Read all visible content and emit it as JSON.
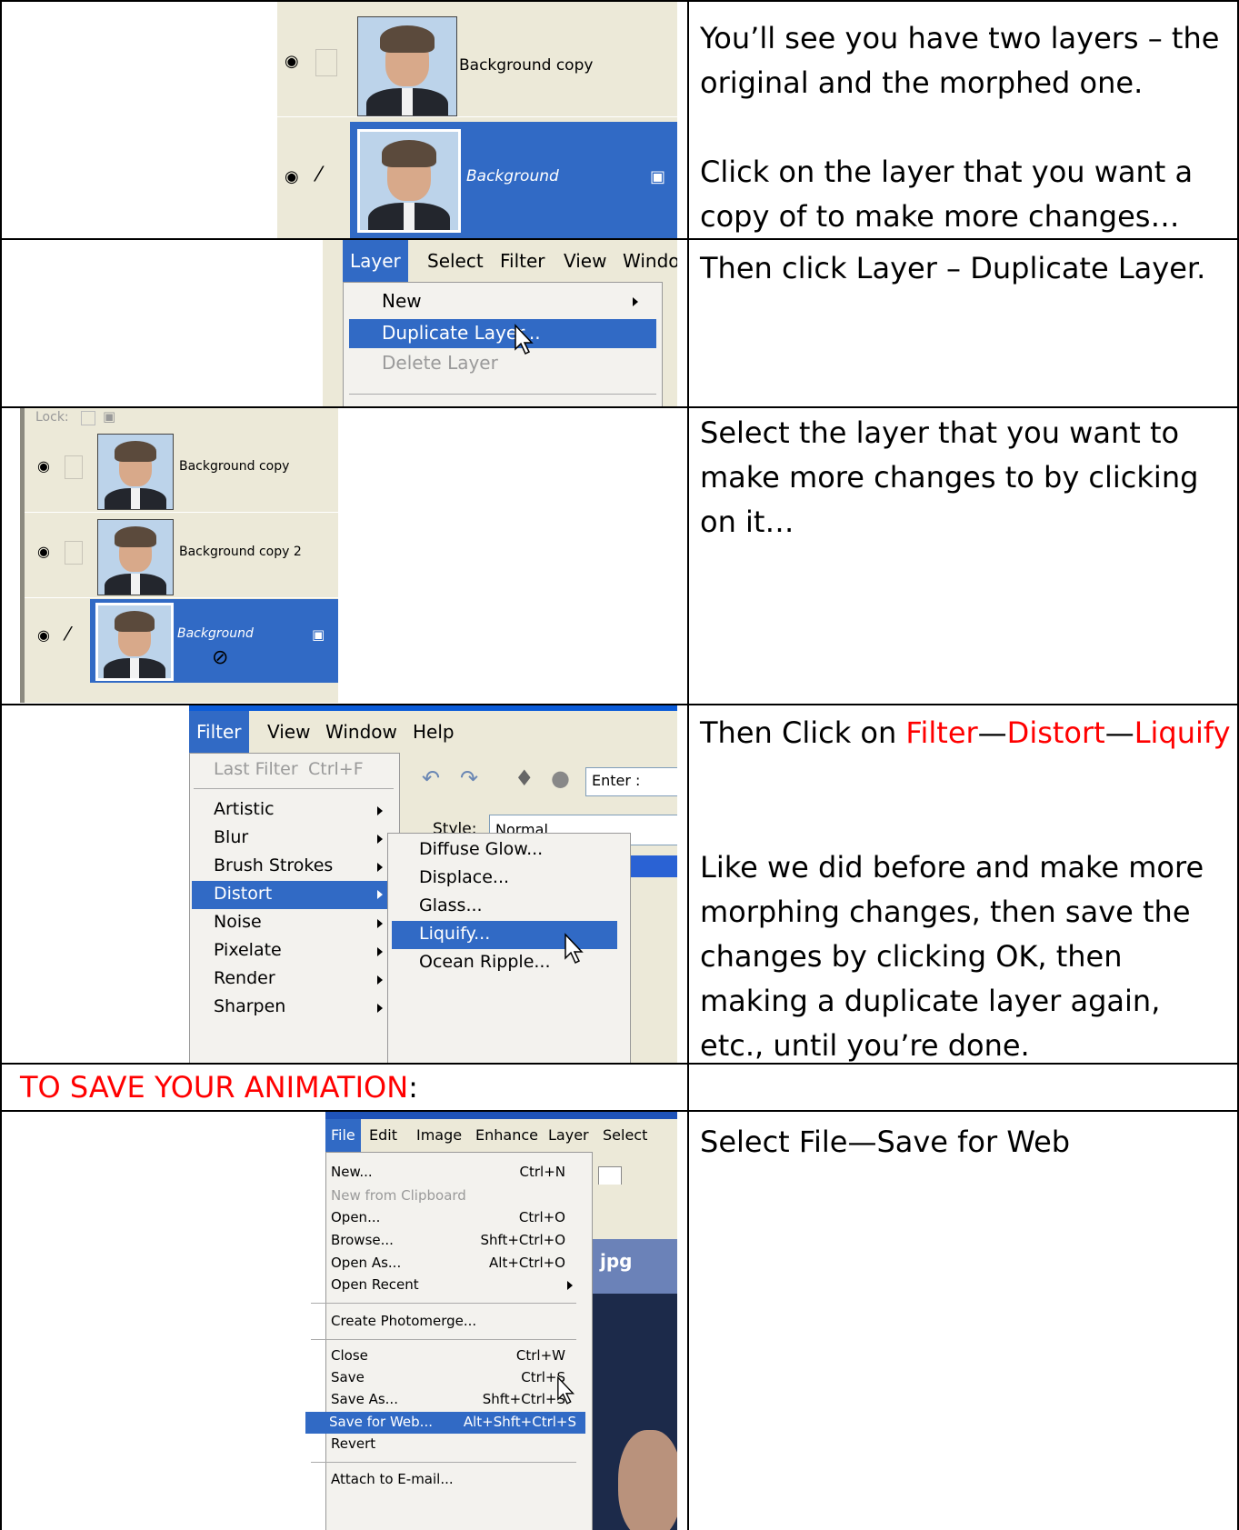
{
  "rows": {
    "r1": {
      "text1": "You’ll see you have two layers – the original and the morphed one.",
      "text2": "Click on the layer that you want a copy of to make more changes…",
      "layers": [
        "Background copy",
        "Background"
      ]
    },
    "r2": {
      "text": "Then click Layer – Duplicate Layer.",
      "menubar": [
        "Layer",
        "Select",
        "Filter",
        "View",
        "Windo"
      ],
      "items": [
        "New",
        "Duplicate Layer...",
        "Delete Layer"
      ]
    },
    "r3": {
      "text": "Select the layer that you want to make more changes to by clicking on it…",
      "lock_label": "Lock:",
      "layers": [
        "Background copy",
        "Background copy 2",
        "Background"
      ]
    },
    "r4": {
      "text_prefix": "Then Click on ",
      "filter": "Filter",
      "dash1": "—",
      "distort": "Distort",
      "dash2": "—",
      "liquify": "Liquify",
      "text2": "Like we did before and make more morphing changes, then save the changes by clicking OK, then making a duplicate layer again, etc., until you’re done.",
      "menubar": [
        "Filter",
        "View",
        "Window",
        "Help"
      ],
      "last_filter": "Last Filter",
      "last_filter_shortcut": "Ctrl+F",
      "items": [
        "Artistic",
        "Blur",
        "Brush Strokes",
        "Distort",
        "Noise",
        "Pixelate",
        "Render",
        "Sharpen"
      ],
      "submenu": [
        "Diffuse Glow...",
        "Displace...",
        "Glass...",
        "Liquify...",
        "Ocean Ripple..."
      ],
      "style_label": "Style:",
      "style_value": "Normal",
      "enter_label": "Enter :"
    },
    "r5": {
      "heading": "TO SAVE YOUR ANIMATION",
      "colon": ":"
    },
    "r6": {
      "text": "Select File—Save for Web",
      "menubar": [
        "File",
        "Edit",
        "Image",
        "Enhance",
        "Layer",
        "Select"
      ],
      "items": [
        {
          "label": "New...",
          "shortcut": "Ctrl+N"
        },
        {
          "label": "New from Clipboard",
          "shortcut": ""
        },
        {
          "label": "Open...",
          "shortcut": "Ctrl+O"
        },
        {
          "label": "Browse...",
          "shortcut": "Shft+Ctrl+O"
        },
        {
          "label": "Open As...",
          "shortcut": "Alt+Ctrl+O"
        },
        {
          "label": "Open Recent",
          "shortcut": ""
        },
        {
          "label": "Create Photomerge...",
          "shortcut": ""
        },
        {
          "label": "Close",
          "shortcut": "Ctrl+W"
        },
        {
          "label": "Save",
          "shortcut": "Ctrl+S"
        },
        {
          "label": "Save As...",
          "shortcut": "Shft+Ctrl+S"
        },
        {
          "label": "Save for Web...",
          "shortcut": "Alt+Shft+Ctrl+S"
        },
        {
          "label": "Revert",
          "shortcut": ""
        },
        {
          "label": "Attach to E-mail...",
          "shortcut": ""
        }
      ],
      "jpg_label": "jpg"
    }
  },
  "colors": {
    "accent": "#ff0000",
    "selection": "#316ac5",
    "panel": "#ece9d8"
  }
}
